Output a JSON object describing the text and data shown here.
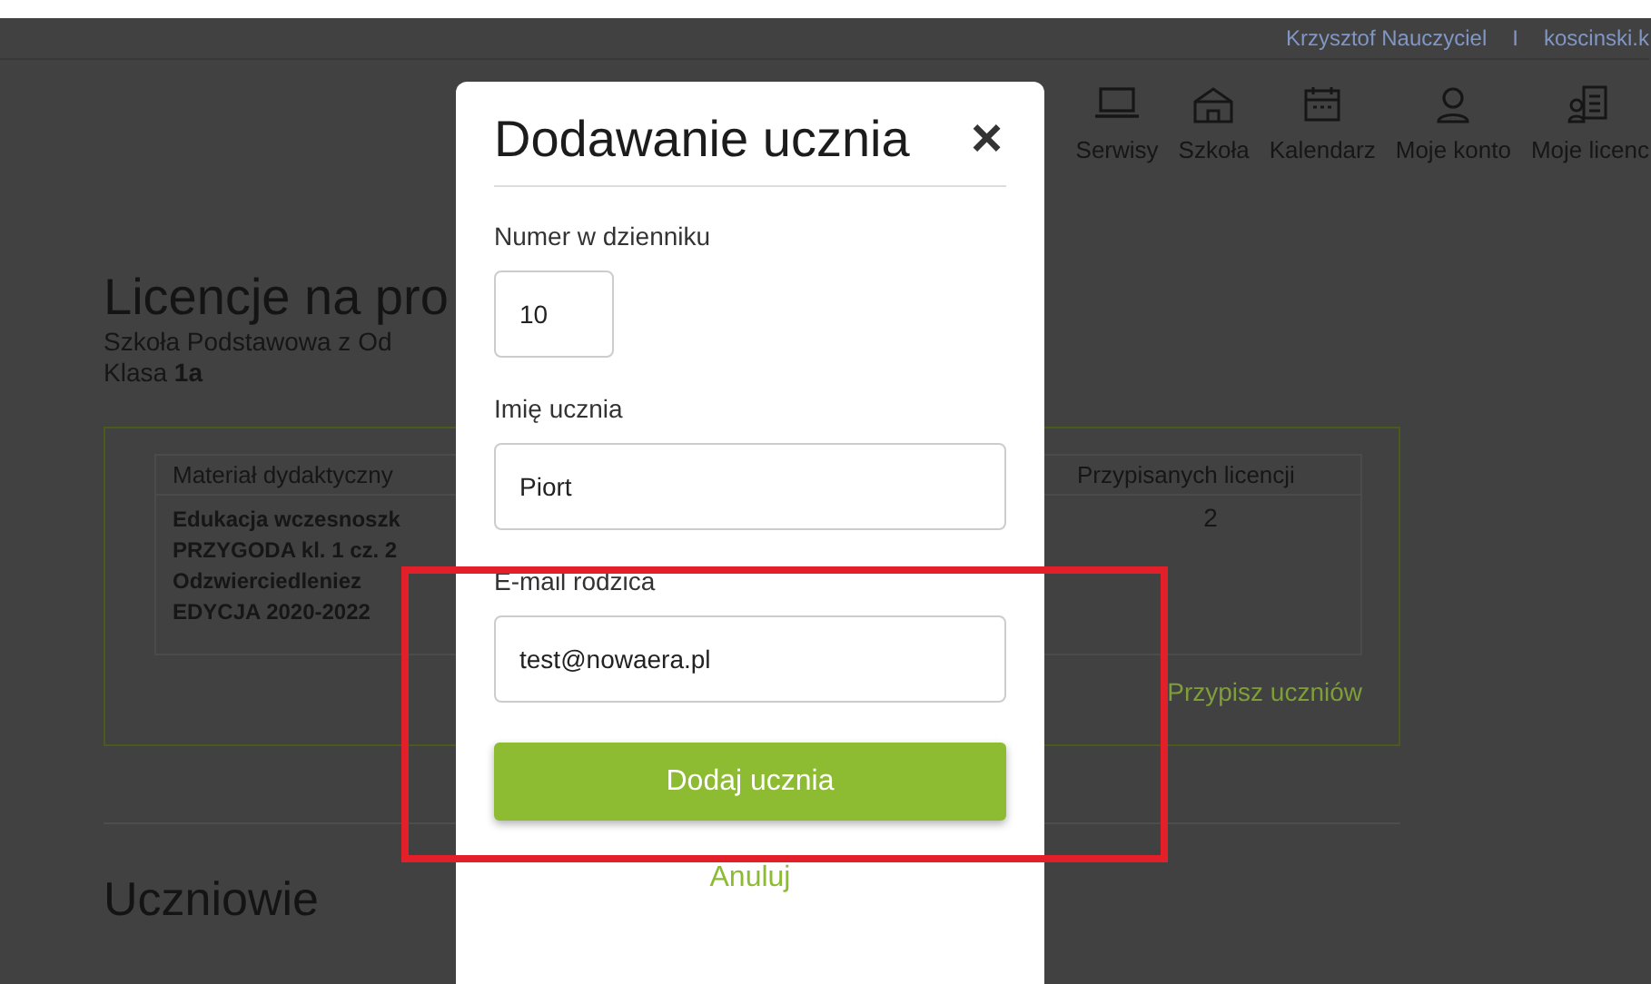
{
  "top_bar": {
    "user": "Krzysztof Nauczyciel",
    "separator": "I",
    "login": "koscinski.k"
  },
  "nav": [
    {
      "label": "Serwisy"
    },
    {
      "label": "Szkoła"
    },
    {
      "label": "Kalendarz"
    },
    {
      "label": "Moje konto"
    },
    {
      "label": "Moje licenc"
    }
  ],
  "page": {
    "title": "Licencje na pro",
    "school": "Szkoła Podstawowa z Od",
    "class_line": "Klasa **1a**"
  },
  "licenses": {
    "columns": [
      "Materiał dydaktyczny",
      "Przypisanych licencji"
    ],
    "rows": [
      {
        "material": [
          "Edukacja wczesnoszk",
          "PRZYGODA kl. 1 cz. 2",
          "Odzwierciedleniez",
          "EDYCJA 2020-2022"
        ],
        "assigned": "2"
      }
    ],
    "link": "Przypisz uczniów"
  },
  "students_heading": "Uczniowie",
  "dialog": {
    "title": "Dodawanie ucznia",
    "close": "×",
    "fields": [
      {
        "label": "Numer w dzienniku",
        "value": "10",
        "kind": "short"
      },
      {
        "label": "Imię ucznia",
        "value": "Piort",
        "kind": "full"
      },
      {
        "label": "E-mail rodzica",
        "value": "test@nowaera.pl",
        "kind": "full"
      }
    ],
    "submit": "Dodaj ucznia",
    "cancel": "Anuluj"
  }
}
